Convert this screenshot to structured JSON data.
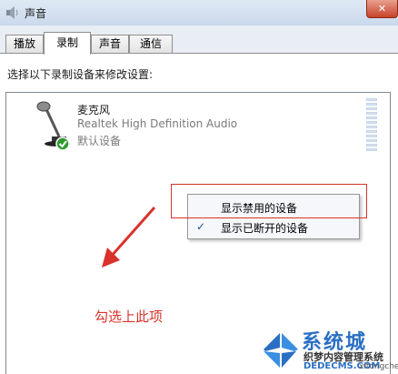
{
  "window": {
    "title": "声音",
    "close_glyph": "✕"
  },
  "tabs": [
    {
      "label": "播放"
    },
    {
      "label": "录制"
    },
    {
      "label": "声音"
    },
    {
      "label": "通信"
    }
  ],
  "active_tab": "录制",
  "panel": {
    "instruction": "选择以下录制设备来修改设置:"
  },
  "device": {
    "name": "麦克风",
    "description": "Realtek High Definition Audio",
    "status": "默认设备",
    "icon": "microphone-icon"
  },
  "context_menu": {
    "items": [
      {
        "label": "显示禁用的设备",
        "checked": false
      },
      {
        "label": "显示已断开的设备",
        "checked": true
      }
    ],
    "check_glyph": "✓"
  },
  "annotation": {
    "text": "勾选上此项",
    "color": "#d9322c"
  },
  "watermark": {
    "brand": "系统城",
    "line1": "织梦内容管理系统",
    "url": "DEDECMS.COM",
    "sub": "xitongcheng.com"
  },
  "colors": {
    "accent": "#2a6fc4",
    "annotation_red": "#d9322c",
    "check_green": "#2f9a2f"
  }
}
